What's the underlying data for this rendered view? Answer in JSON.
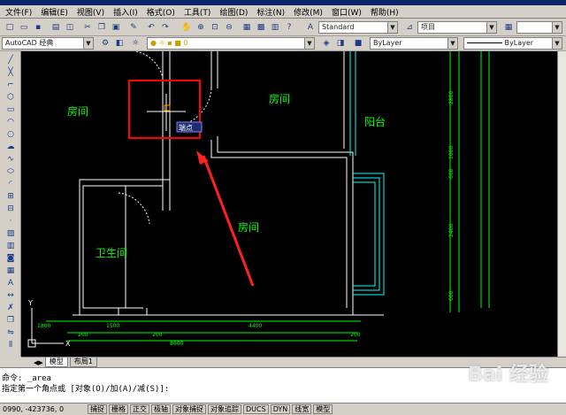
{
  "menu": [
    "文件(F)",
    "编辑(E)",
    "视图(V)",
    "插入(I)",
    "格式(O)",
    "工具(T)",
    "绘图(D)",
    "标注(N)",
    "修改(M)",
    "窗口(W)",
    "帮助(H)"
  ],
  "toolbar": {
    "workspace": "AutoCAD 经典",
    "text_style": "Standard",
    "dim_style": "项目",
    "color": "ByLayer",
    "linetype": "ByLayer"
  },
  "drawing": {
    "rooms": [
      "房间",
      "房间",
      "阳台",
      "卫生间",
      "房间"
    ],
    "tooltip": "端点",
    "dims_bottom": [
      "1800",
      "1500",
      "4400",
      "200",
      "200",
      "200",
      "8600"
    ],
    "dims_right": [
      "2800",
      "1000",
      "600",
      "2400",
      "600"
    ]
  },
  "tabs": [
    "模型",
    "布局1"
  ],
  "command": {
    "line1": "命令: _area",
    "line2": "指定第一个角点或 [对象(O)/加(A)/减(S)]:"
  },
  "status": {
    "coords": "0990, -423736, 0",
    "buttons": [
      "捕捉",
      "栅格",
      "正交",
      "极轴",
      "对象捕捉",
      "对象追踪",
      "DUCS",
      "DYN",
      "线宽",
      "模型"
    ]
  },
  "watermark": "Bai 经验",
  "colors": {
    "wall": "#ffffff",
    "room_text": "#00ff00",
    "dims": "#00ff00",
    "highlight": "#ff0000",
    "window": "#00ffff"
  }
}
